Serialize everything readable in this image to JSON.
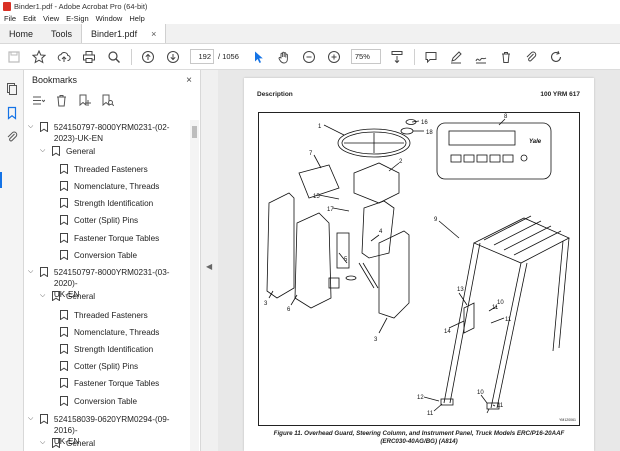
{
  "window": {
    "title": "Binder1.pdf - Adobe Acrobat Pro (64-bit)"
  },
  "menu": [
    "File",
    "Edit",
    "View",
    "E-Sign",
    "Window",
    "Help"
  ],
  "tabs": {
    "home": "Home",
    "tools": "Tools",
    "document": "Binder1.pdf",
    "close_glyph": "×"
  },
  "toolbar": {
    "page_current": "192",
    "page_separator": "/",
    "page_total": "1056",
    "zoom": "75%"
  },
  "bookmarks": {
    "title": "Bookmarks",
    "close_glyph": "×",
    "items": [
      {
        "label": "524150797-8000YRM0231-(02-2023)-UK-EN",
        "line2": "UK-EN"
      },
      {
        "label": "General"
      },
      {
        "label": "Threaded Fasteners"
      },
      {
        "label": "Nomenclature, Threads"
      },
      {
        "label": "Strength Identification"
      },
      {
        "label": "Cotter (Split) Pins"
      },
      {
        "label": "Fastener Torque Tables"
      },
      {
        "label": "Conversion Table"
      },
      {
        "label": "524150797-8000YRM0231-(03-2020)-",
        "line2": "UK-EN"
      },
      {
        "label": "General"
      },
      {
        "label": "Threaded Fasteners"
      },
      {
        "label": "Nomenclature, Threads"
      },
      {
        "label": "Strength Identification"
      },
      {
        "label": "Cotter (Split) Pins"
      },
      {
        "label": "Fastener Torque Tables"
      },
      {
        "label": "Conversion Table"
      },
      {
        "label": "524158039-0620YRM0294-(09-2016)-",
        "line2": "UK-EN"
      },
      {
        "label": "General"
      }
    ]
  },
  "document": {
    "header_left": "Description",
    "header_right": "100 YRM 617",
    "caption_line1": "Figure 11.  Overhead Guard, Steering Column, and Instrument Panel, Truck Models ERC/P16-20AAF",
    "caption_line2": "(ERC030-40AG/BG) (A814)",
    "figure_id": "YM120061",
    "panel_brand": "Yale",
    "callouts": [
      "1",
      "16",
      "18",
      "8",
      "7",
      "2",
      "15",
      "17",
      "9",
      "3",
      "4",
      "5",
      "6",
      "13",
      "14",
      "11",
      "10",
      "11",
      "12",
      "11",
      "10",
      "11",
      "3"
    ]
  }
}
